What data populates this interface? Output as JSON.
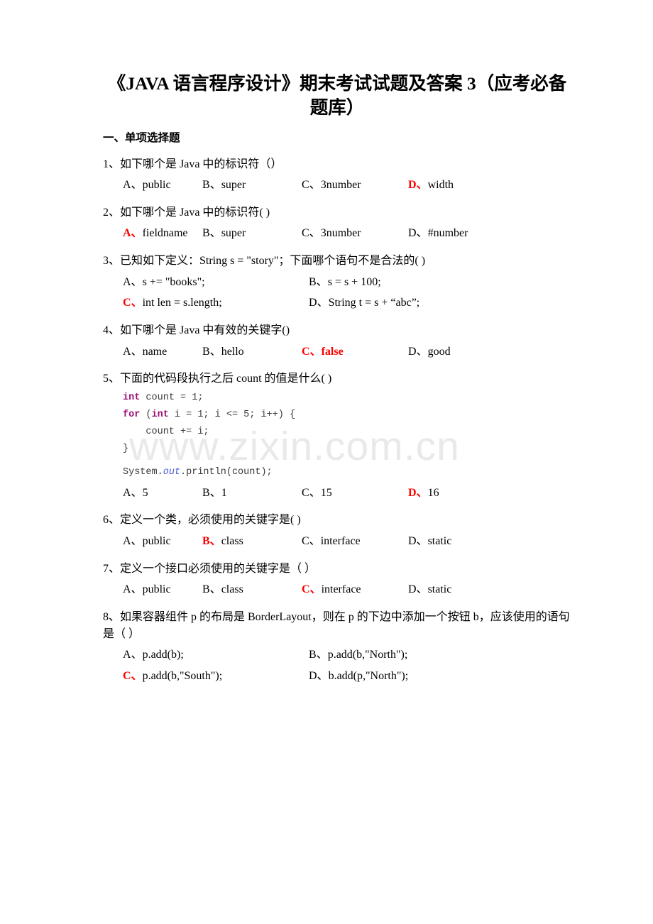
{
  "document": {
    "title": "《JAVA 语言程序设计》期末考试试题及答案 3（应考必备题库）",
    "watermark": "www.zixin.com.cn",
    "section_heading": "一、单项选择题",
    "accent_color": "#ff0000",
    "questions": [
      {
        "number": "1、",
        "stem": "1、如下哪个是 Java 中的标识符（）",
        "layout": "four-col",
        "options": [
          {
            "mark": "A、",
            "text": "public",
            "answer": false
          },
          {
            "mark": "B、",
            "text": "super",
            "answer": false
          },
          {
            "mark": "C、",
            "text": "3number",
            "answer": false
          },
          {
            "mark": "D、",
            "text": "width",
            "answer": true
          }
        ]
      },
      {
        "number": "2、",
        "stem": "2、如下哪个是 Java 中的标识符( )",
        "layout": "four-col",
        "options": [
          {
            "mark": "A、",
            "text": "fieldname",
            "answer": true
          },
          {
            "mark": "B、",
            "text": "super",
            "answer": false
          },
          {
            "mark": "C、",
            "text": "3number",
            "answer": false
          },
          {
            "mark": "D、",
            "text": "#number",
            "answer": false
          }
        ]
      },
      {
        "number": "3、",
        "stem": "3、已知如下定义：String s = \"story\"；下面哪个语句不是合法的( )",
        "layout": "two-col",
        "options": [
          {
            "mark": "A、",
            "text": "s += \"books\";",
            "answer": false
          },
          {
            "mark": "B、",
            "text": "s = s + 100;",
            "answer": false
          },
          {
            "mark": "C、",
            "text": "int len = s.length;",
            "answer": true
          },
          {
            "mark": "D、",
            "text": "String t = s + “abc”;",
            "answer": false
          }
        ]
      },
      {
        "number": "4、",
        "stem": "4、如下哪个是 Java 中有效的关键字()",
        "layout": "four-col",
        "options": [
          {
            "mark": "A、",
            "text": "name",
            "answer": false
          },
          {
            "mark": "B、",
            "text": "hello",
            "answer": false
          },
          {
            "mark": "C、",
            "text": "false",
            "answer": true,
            "all_red": true
          },
          {
            "mark": "D、",
            "text": "good",
            "answer": false
          }
        ]
      },
      {
        "number": "5、",
        "stem": "5、下面的代码段执行之后 count 的值是什么(            )",
        "layout": "four-col",
        "code_lines": [
          [
            {
              "t": "int",
              "c": "kw"
            },
            {
              "t": " count = 1;",
              "c": ""
            }
          ],
          [
            {
              "t": "for",
              "c": "kw"
            },
            {
              "t": " (",
              "c": ""
            },
            {
              "t": "int",
              "c": "kw"
            },
            {
              "t": " i = 1; i <= 5; i++) {",
              "c": ""
            }
          ],
          [
            {
              "t": "    count += i;",
              "c": ""
            }
          ],
          [
            {
              "t": "}",
              "c": ""
            }
          ],
          [
            {
              "t": "",
              "c": ""
            }
          ],
          [
            {
              "t": "System.",
              "c": ""
            },
            {
              "t": "out",
              "c": "fld"
            },
            {
              "t": ".println(count);",
              "c": ""
            }
          ]
        ],
        "options": [
          {
            "mark": "A、",
            "text": "5",
            "answer": false
          },
          {
            "mark": "B、",
            "text": "1",
            "answer": false
          },
          {
            "mark": "C、",
            "text": "15",
            "answer": false
          },
          {
            "mark": "D、",
            "text": "16",
            "answer": true
          }
        ]
      },
      {
        "number": "6、",
        "stem": "6、定义一个类，必须使用的关键字是(   )",
        "layout": "four-col",
        "options": [
          {
            "mark": "A、",
            "text": "public",
            "answer": false
          },
          {
            "mark": "B、",
            "text": "class",
            "answer": true
          },
          {
            "mark": "C、",
            "text": "interface",
            "answer": false
          },
          {
            "mark": "D、",
            "text": "static",
            "answer": false
          }
        ]
      },
      {
        "number": "7、",
        "stem": "7、定义一个接口必须使用的关键字是（         ）",
        "layout": "four-col",
        "options": [
          {
            "mark": "A、",
            "text": "public",
            "answer": false
          },
          {
            "mark": "B、",
            "text": "class",
            "answer": false
          },
          {
            "mark": "C、",
            "text": "interface",
            "answer": true
          },
          {
            "mark": "D、",
            "text": "static",
            "answer": false
          }
        ]
      },
      {
        "number": "8、",
        "stem": "8、如果容器组件 p 的布局是 BorderLayout，则在 p 的下边中添加一个按钮 b，应该使用的语句是（  ）",
        "layout": "two-col",
        "options": [
          {
            "mark": "A、",
            "text": "p.add(b);",
            "answer": false
          },
          {
            "mark": "B、",
            "text": "p.add(b,\"North\");",
            "answer": false
          },
          {
            "mark": "C、",
            "text": "p.add(b,\"South\");",
            "answer": true
          },
          {
            "mark": "D、",
            "text": "b.add(p,\"North\");",
            "answer": false
          }
        ]
      }
    ]
  }
}
